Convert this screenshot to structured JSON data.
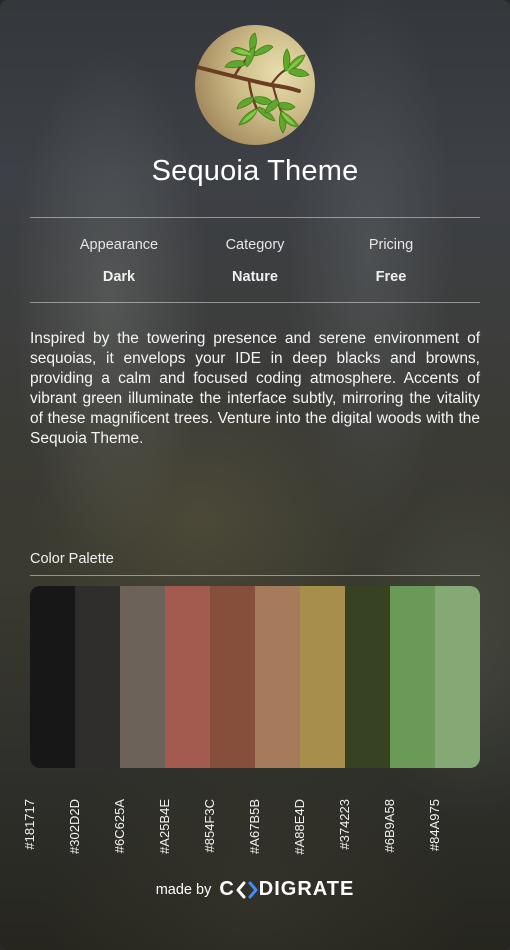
{
  "theme": {
    "name": "Sequoia Theme",
    "image_icon": "sequoia-branch-icon"
  },
  "meta": [
    {
      "label": "Appearance",
      "value": "Dark"
    },
    {
      "label": "Category",
      "value": "Nature"
    },
    {
      "label": "Pricing",
      "value": "Free"
    }
  ],
  "description": "Inspired by the towering presence and serene environment of sequoias, it envelops your IDE in deep blacks and browns, providing a calm and focused coding atmosphere. Accents of vibrant green illuminate the interface subtly, mirroring the vitality of these magnificent trees. Venture into the digital woods with the Sequoia Theme.",
  "palette": {
    "heading": "Color Palette",
    "colors": [
      "#181717",
      "#302D2D",
      "#6C625A",
      "#A25B4E",
      "#854F3C",
      "#A67B5B",
      "#A88E4D",
      "#374223",
      "#6B9A58",
      "#84A975"
    ]
  },
  "footer": {
    "made_by": "made by",
    "brand_prefix": "C",
    "brand_suffix": "DIGRATE",
    "brand_icon": "codigrate-logo-icon"
  }
}
